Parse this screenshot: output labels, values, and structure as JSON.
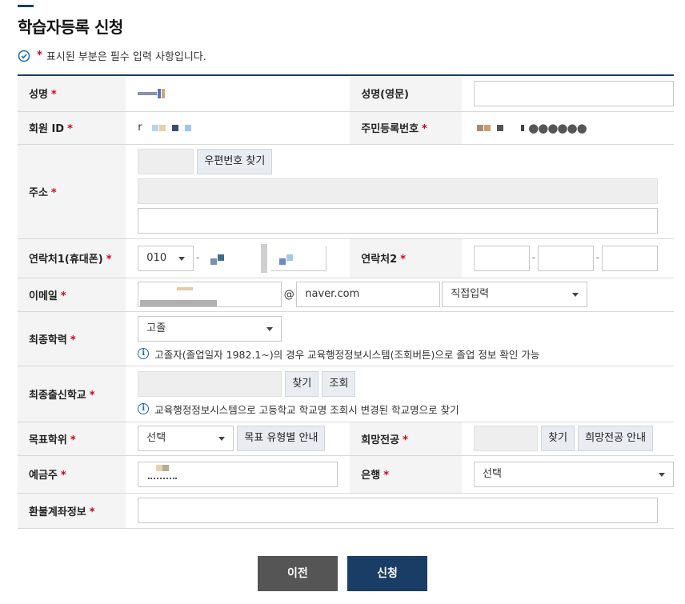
{
  "page": {
    "title": "학습자등록 신청",
    "required_note": "표시된 부분은 필수 입력 사항입니다.",
    "required_mark": "*"
  },
  "form": {
    "name": {
      "label": "성명"
    },
    "name_en": {
      "label": "성명(영문)",
      "value": ""
    },
    "member_id": {
      "label": "회원 ID",
      "prefix": "r"
    },
    "resident_no": {
      "label": "주민등록번호"
    },
    "address": {
      "label": "주소",
      "zip_button": "우편번호 찾기",
      "detail_value": ""
    },
    "phone1": {
      "label": "연락처1(휴대폰)",
      "prefix_value": "010"
    },
    "phone2": {
      "label": "연락처2"
    },
    "email": {
      "label": "이메일",
      "at": "@",
      "domain": "naver.com",
      "domain_select": "직접입력"
    },
    "education": {
      "label": "최종학력",
      "value": "고졸",
      "info": "고졸자(졸업일자 1982.1~)의 경우 교육행정정보시스템(조회버튼)으로 졸업 정보 확인 가능"
    },
    "school": {
      "label": "최종출신학교",
      "find_button": "찾기",
      "lookup_button": "조회",
      "info": "교육행정정보시스템으로 고등학교 학교명 조회시 변경된 학교명으로 찾기"
    },
    "target_degree": {
      "label": "목표학위",
      "value": "선택",
      "guide_button": "목표 유형별 안내"
    },
    "desired_major": {
      "label": "희망전공",
      "find_button": "찾기",
      "guide_button": "희망전공 안내"
    },
    "depositor": {
      "label": "예금주"
    },
    "bank": {
      "label": "은행",
      "value": "선택"
    },
    "refund_account": {
      "label": "환불계좌정보",
      "value": ""
    }
  },
  "buttons": {
    "prev": "이전",
    "apply": "신청"
  },
  "colors": {
    "accent": "#1a3d66",
    "required": "#d0021b",
    "info": "#1a66b3",
    "label_bg": "#f4f4f4"
  }
}
